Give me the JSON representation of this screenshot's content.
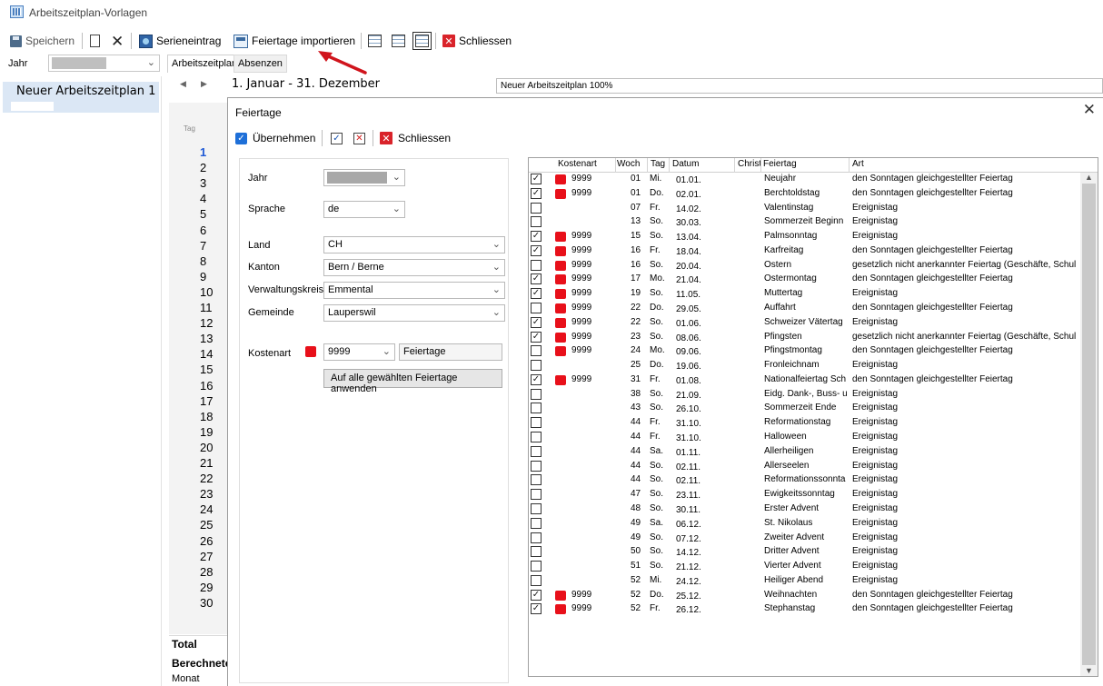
{
  "window": {
    "title": "Arbeitszeitplan-Vorlagen"
  },
  "toolbar": {
    "save": "Speichern",
    "serie": "Serieneintrag",
    "import": "Feiertage importieren",
    "close": "Schliessen"
  },
  "row2": {
    "jahr_label": "Jahr",
    "tabs": [
      "Arbeitszeitplan",
      "Absenzen"
    ]
  },
  "left": {
    "plan_item": "Neuer Arbeitszeitplan 1"
  },
  "main": {
    "range": "1. Januar - 31. Dezember",
    "plan_name": "Neuer Arbeitszeitplan 100%",
    "tag_label": "Tag",
    "days": [
      "1",
      "2",
      "3",
      "4",
      "5",
      "6",
      "7",
      "8",
      "9",
      "10",
      "11",
      "12",
      "13",
      "14",
      "15",
      "16",
      "17",
      "18",
      "19",
      "20",
      "21",
      "22",
      "23",
      "24",
      "25",
      "26",
      "27",
      "28",
      "29",
      "30"
    ],
    "total": "Total",
    "berechnet": "Berechnete",
    "monat": "Monat"
  },
  "dialog": {
    "title": "Feiertage",
    "uebernehmen": "Übernehmen",
    "schliessen": "Schliessen",
    "form": {
      "jahr": "Jahr",
      "sprache": "Sprache",
      "sprache_val": "de",
      "land": "Land",
      "land_val": "CH",
      "kanton": "Kanton",
      "kanton_val": "Bern / Berne",
      "verw": "Verwaltungskreis",
      "verw_val": "Emmental",
      "gemeinde": "Gemeinde",
      "gemeinde_val": "Lauperswil",
      "kostenart": "Kostenart",
      "kostenart_val": "9999",
      "kostenart_name": "Feiertage",
      "apply_btn": "Auf alle gewählten Feiertage anwenden"
    },
    "table": {
      "headers": [
        "Kostenart",
        "Woch",
        "Tag",
        "Datum",
        "Christl",
        "Feiertag",
        "Art"
      ],
      "rows": [
        {
          "c": "x",
          "k": "9999",
          "w": "01",
          "t": "Mi.",
          "d": "01.01.",
          "f": "Neujahr",
          "a": "den Sonntagen gleichgestellter Feiertag"
        },
        {
          "c": "x",
          "k": "9999",
          "w": "01",
          "t": "Do.",
          "d": "02.01.",
          "f": "Berchtoldstag",
          "a": "den Sonntagen gleichgestellter Feiertag"
        },
        {
          "c": "",
          "k": "",
          "w": "07",
          "t": "Fr.",
          "d": "14.02.",
          "f": "Valentinstag",
          "a": "Ereignistag"
        },
        {
          "c": "",
          "k": "",
          "w": "13",
          "t": "So.",
          "d": "30.03.",
          "f": "Sommerzeit Beginn",
          "a": "Ereignistag"
        },
        {
          "c": "x",
          "k": "9999",
          "w": "15",
          "t": "So.",
          "d": "13.04.",
          "f": "Palmsonntag",
          "a": "Ereignistag"
        },
        {
          "c": "x",
          "k": "9999",
          "w": "16",
          "t": "Fr.",
          "d": "18.04.",
          "f": "Karfreitag",
          "a": "den Sonntagen gleichgestellter Feiertag"
        },
        {
          "c": "",
          "k": "9999",
          "w": "16",
          "t": "So.",
          "d": "20.04.",
          "f": "Ostern",
          "a": "gesetzlich nicht anerkannter Feiertag (Geschäfte, Schul"
        },
        {
          "c": "x",
          "k": "9999",
          "w": "17",
          "t": "Mo.",
          "d": "21.04.",
          "f": "Ostermontag",
          "a": "den Sonntagen gleichgestellter Feiertag"
        },
        {
          "c": "x",
          "k": "9999",
          "w": "19",
          "t": "So.",
          "d": "11.05.",
          "f": "Muttertag",
          "a": "Ereignistag"
        },
        {
          "c": "",
          "k": "9999",
          "w": "22",
          "t": "Do.",
          "d": "29.05.",
          "f": "Auffahrt",
          "a": "den Sonntagen gleichgestellter Feiertag"
        },
        {
          "c": "x",
          "k": "9999",
          "w": "22",
          "t": "So.",
          "d": "01.06.",
          "f": "Schweizer Vätertag",
          "a": "Ereignistag"
        },
        {
          "c": "x",
          "k": "9999",
          "w": "23",
          "t": "So.",
          "d": "08.06.",
          "f": "Pfingsten",
          "a": "gesetzlich nicht anerkannter Feiertag (Geschäfte, Schul"
        },
        {
          "c": "",
          "k": "9999",
          "w": "24",
          "t": "Mo.",
          "d": "09.06.",
          "f": "Pfingstmontag",
          "a": "den Sonntagen gleichgestellter Feiertag"
        },
        {
          "c": "",
          "k": "",
          "w": "25",
          "t": "Do.",
          "d": "19.06.",
          "f": "Fronleichnam",
          "a": "Ereignistag"
        },
        {
          "c": "x",
          "k": "9999",
          "w": "31",
          "t": "Fr.",
          "d": "01.08.",
          "f": "Nationalfeiertag Sch",
          "a": "den Sonntagen gleichgestellter Feiertag"
        },
        {
          "c": "",
          "k": "",
          "w": "38",
          "t": "So.",
          "d": "21.09.",
          "f": "Eidg. Dank-, Buss- u",
          "a": "Ereignistag"
        },
        {
          "c": "",
          "k": "",
          "w": "43",
          "t": "So.",
          "d": "26.10.",
          "f": "Sommerzeit Ende",
          "a": "Ereignistag"
        },
        {
          "c": "",
          "k": "",
          "w": "44",
          "t": "Fr.",
          "d": "31.10.",
          "f": "Reformationstag",
          "a": "Ereignistag"
        },
        {
          "c": "",
          "k": "",
          "w": "44",
          "t": "Fr.",
          "d": "31.10.",
          "f": "Halloween",
          "a": "Ereignistag"
        },
        {
          "c": "",
          "k": "",
          "w": "44",
          "t": "Sa.",
          "d": "01.11.",
          "f": "Allerheiligen",
          "a": "Ereignistag"
        },
        {
          "c": "",
          "k": "",
          "w": "44",
          "t": "So.",
          "d": "02.11.",
          "f": "Allerseelen",
          "a": "Ereignistag"
        },
        {
          "c": "",
          "k": "",
          "w": "44",
          "t": "So.",
          "d": "02.11.",
          "f": "Reformationssonnta",
          "a": "Ereignistag"
        },
        {
          "c": "",
          "k": "",
          "w": "47",
          "t": "So.",
          "d": "23.11.",
          "f": "Ewigkeitssonntag",
          "a": "Ereignistag"
        },
        {
          "c": "",
          "k": "",
          "w": "48",
          "t": "So.",
          "d": "30.11.",
          "f": "Erster Advent",
          "a": "Ereignistag"
        },
        {
          "c": "",
          "k": "",
          "w": "49",
          "t": "Sa.",
          "d": "06.12.",
          "f": "St. Nikolaus",
          "a": "Ereignistag"
        },
        {
          "c": "",
          "k": "",
          "w": "49",
          "t": "So.",
          "d": "07.12.",
          "f": "Zweiter Advent",
          "a": "Ereignistag"
        },
        {
          "c": "",
          "k": "",
          "w": "50",
          "t": "So.",
          "d": "14.12.",
          "f": "Dritter Advent",
          "a": "Ereignistag"
        },
        {
          "c": "",
          "k": "",
          "w": "51",
          "t": "So.",
          "d": "21.12.",
          "f": "Vierter Advent",
          "a": "Ereignistag"
        },
        {
          "c": "",
          "k": "",
          "w": "52",
          "t": "Mi.",
          "d": "24.12.",
          "f": "Heiliger Abend",
          "a": "Ereignistag"
        },
        {
          "c": "x",
          "k": "9999",
          "w": "52",
          "t": "Do.",
          "d": "25.12.",
          "f": "Weihnachten",
          "a": "den Sonntagen gleichgestellter Feiertag"
        },
        {
          "c": "x",
          "k": "9999",
          "w": "52",
          "t": "Fr.",
          "d": "26.12.",
          "f": "Stephanstag",
          "a": "den Sonntagen gleichgestellter Feiertag"
        }
      ]
    }
  },
  "colors": {
    "accent": "#1e6fd8",
    "kostenart_red": "#e8101a",
    "selection": "#dbe7f5",
    "arrow": "#d0141c"
  }
}
